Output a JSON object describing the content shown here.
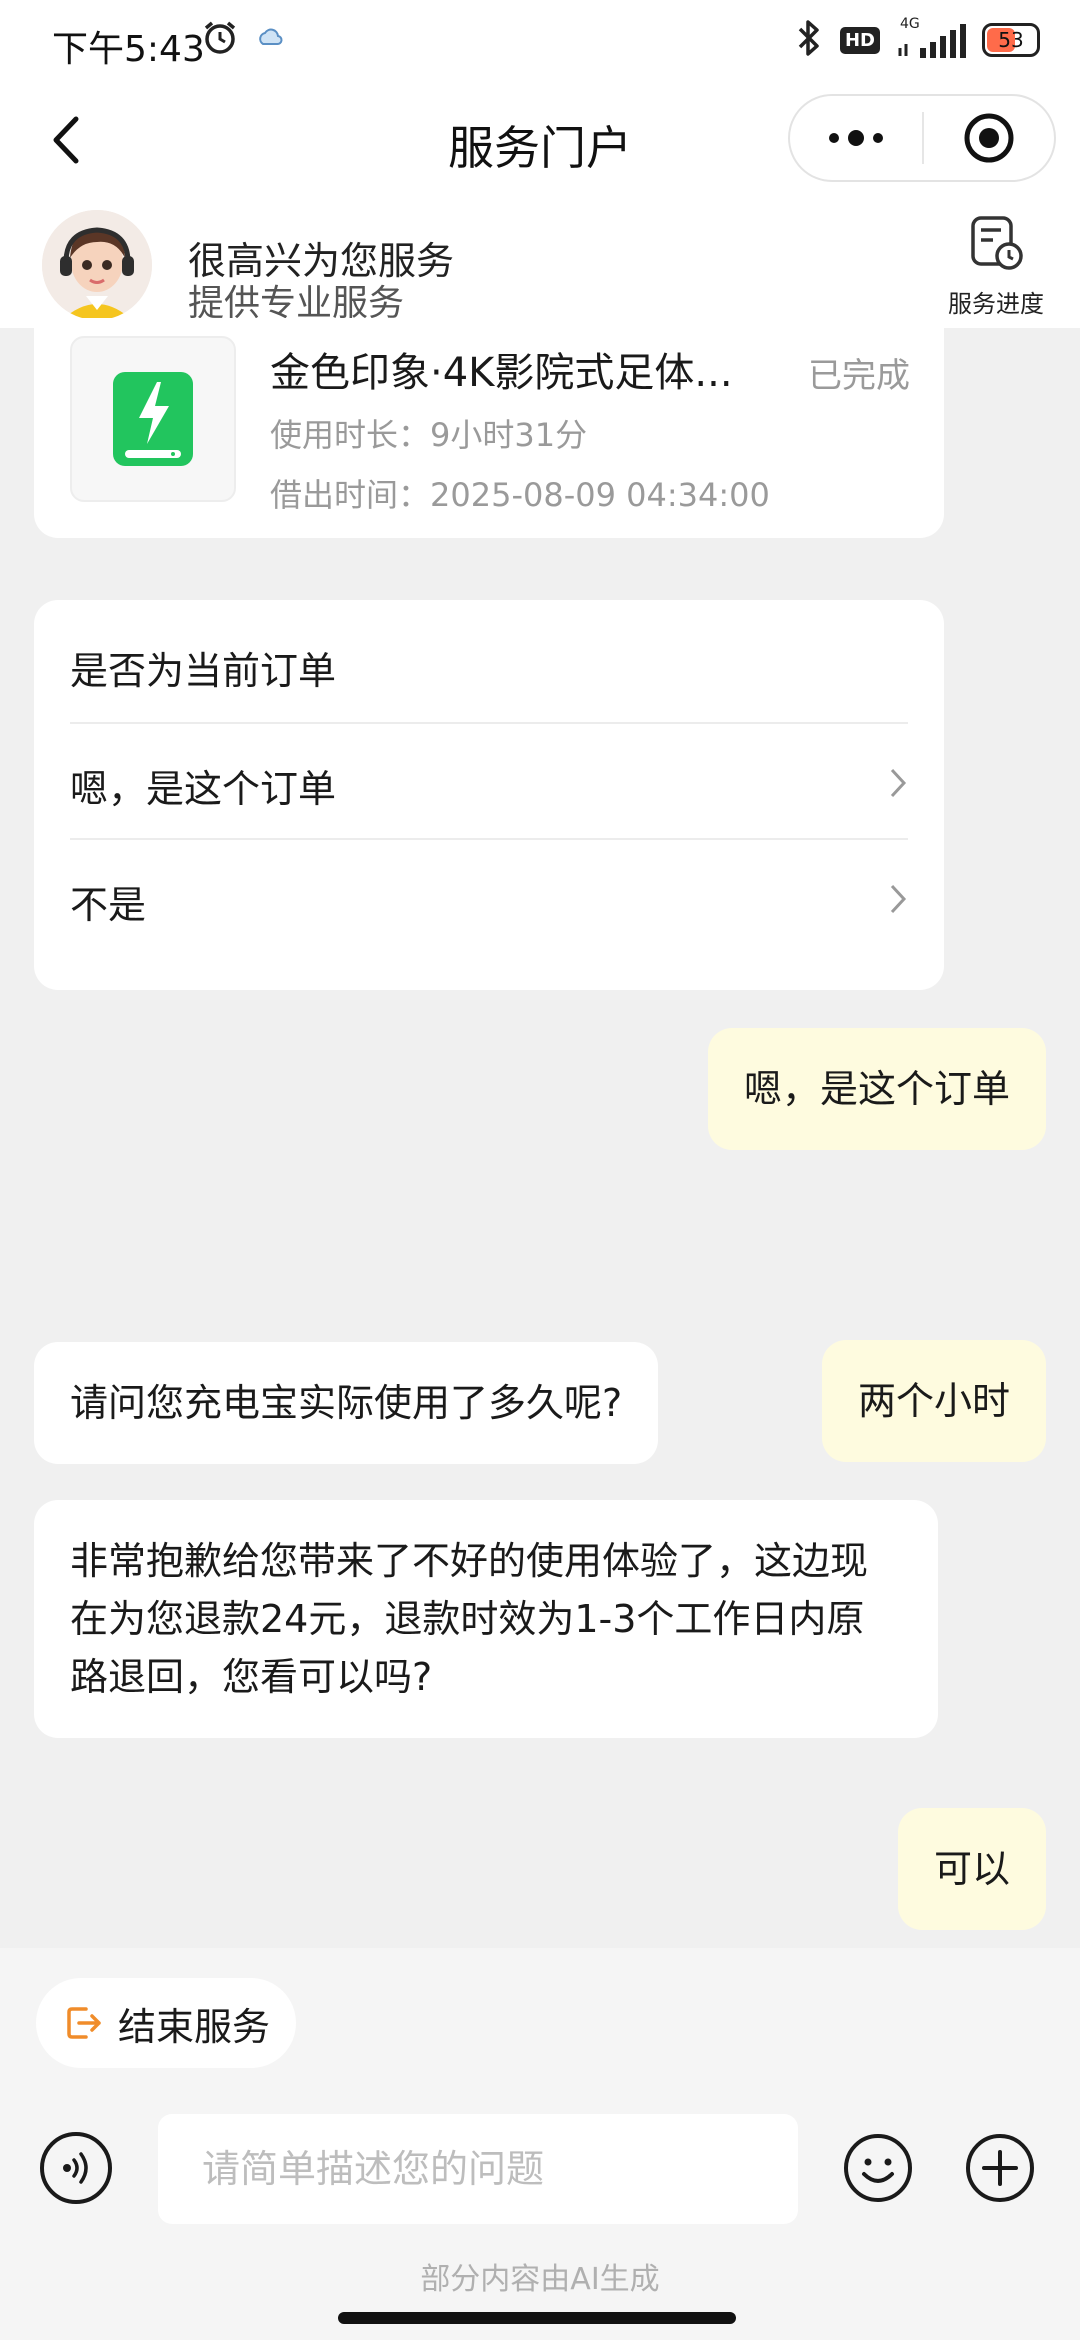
{
  "status_bar": {
    "time": "下午5:43",
    "network": "4G",
    "hd": "HD",
    "battery": "53"
  },
  "nav": {
    "title": "服务门户",
    "icons": [
      "back-chevron-icon",
      "more-dots-icon",
      "close-circle-icon"
    ]
  },
  "agent": {
    "greeting": "很高兴为您服务",
    "subtitle": "提供专业服务",
    "progress_label": "服务进度"
  },
  "order": {
    "name": "金色印象·4K影院式足体...",
    "status": "已完成",
    "duration_label": "使用时长：",
    "duration_value": "9小时31分",
    "borrow_label": "借出时间：",
    "borrow_value": "2025-08-09 04:34:00",
    "thumb_color": "#22c55e"
  },
  "question": {
    "title": "是否为当前订单",
    "options": [
      "嗯，是这个订单",
      "不是"
    ]
  },
  "messages": [
    {
      "role": "user",
      "text": "嗯，是这个订单"
    },
    {
      "role": "bot",
      "text": "请问您充电宝实际使用了多久呢?"
    },
    {
      "role": "user",
      "text": "两个小时"
    },
    {
      "role": "bot",
      "text": "非常抱歉给您带来了不好的使用体验了，这边现在为您退款24元，退款时效为1-3个工作日内原路退回，您看可以吗?"
    },
    {
      "role": "user",
      "text": "可以"
    }
  ],
  "bottom": {
    "end_service": "结束服务",
    "input_placeholder": "请简单描述您的问题",
    "ai_note": "部分内容由AI生成"
  },
  "colors": {
    "user_bubble": "#fefbdf",
    "accent_orange": "#f08c2a",
    "background": "#f0f0f0"
  }
}
